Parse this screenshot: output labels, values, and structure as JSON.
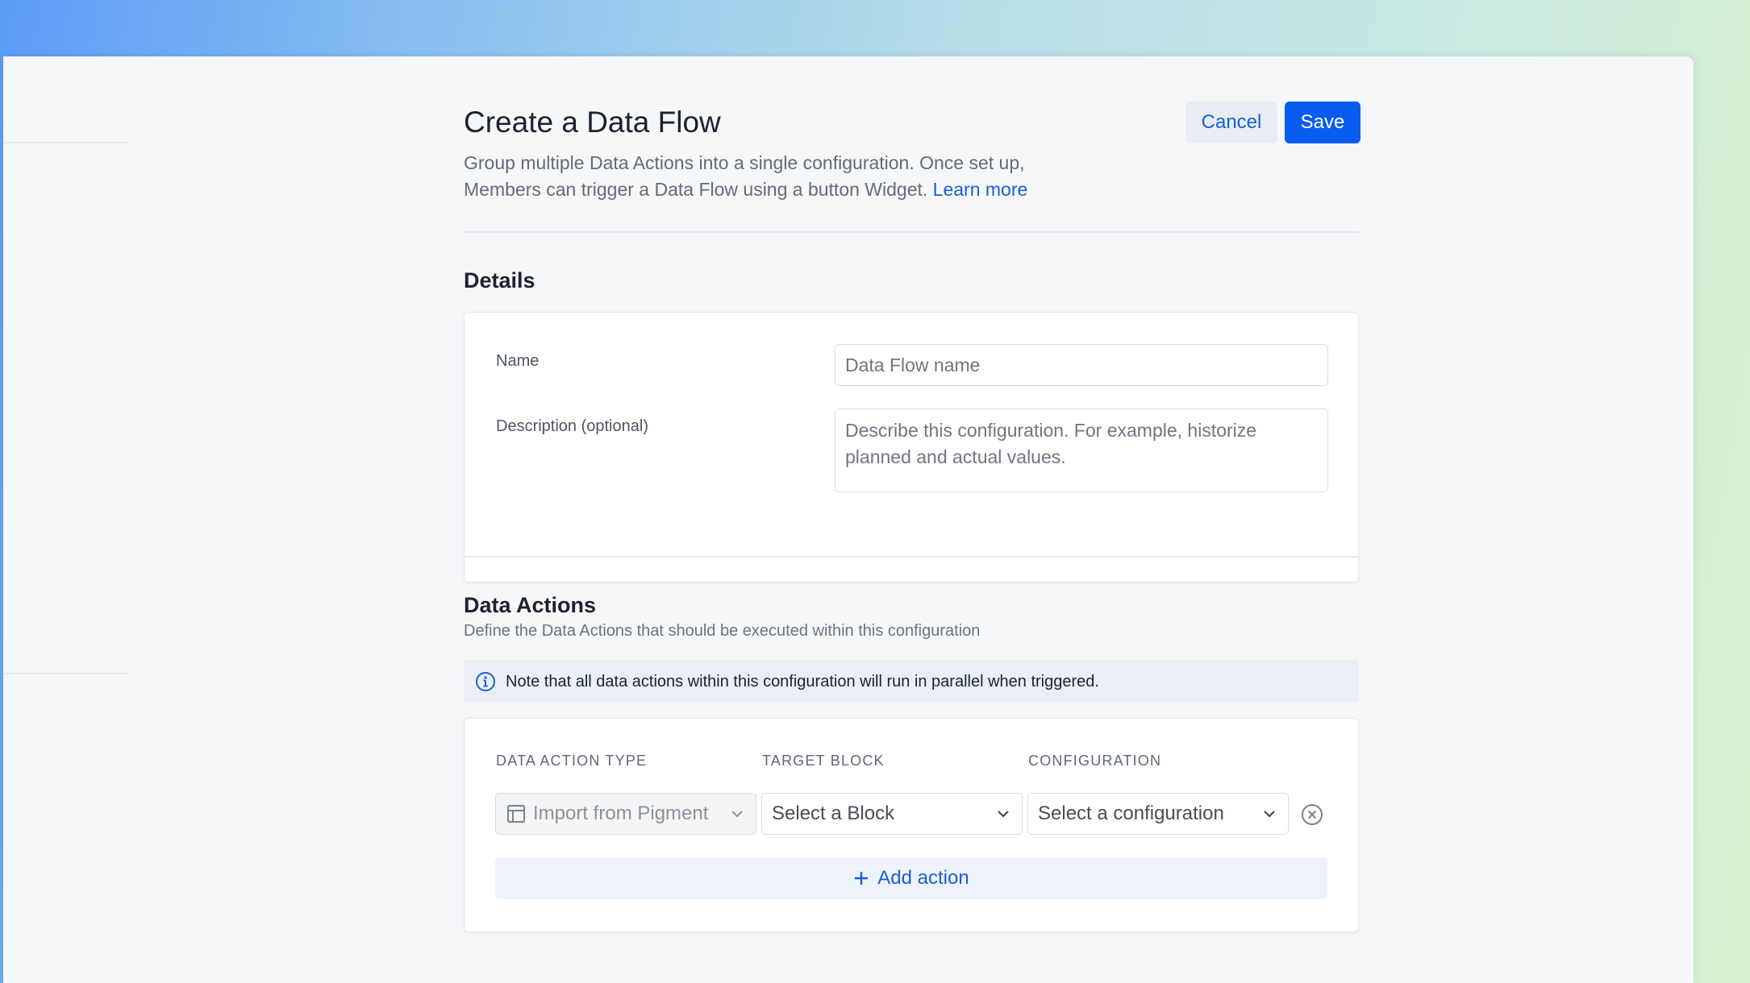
{
  "header": {
    "title": "Create a Data Flow",
    "description": "Group multiple Data Actions into a single configuration. Once set up, Members can trigger a Data Flow using a button Widget.",
    "learn_more": "Learn more",
    "cancel_label": "Cancel",
    "save_label": "Save"
  },
  "details": {
    "title": "Details",
    "name_label": "Name",
    "name_value": "",
    "name_placeholder": "Data Flow name",
    "description_label": "Description (optional)",
    "description_value": "",
    "description_placeholder": "Describe this configuration. For example, historize planned and actual values."
  },
  "data_actions": {
    "title": "Data Actions",
    "subtitle": "Define the Data Actions that should be executed within this configuration",
    "note": "Note that all data actions within this configuration will run in parallel when triggered.",
    "columns": [
      "DATA ACTION TYPE",
      "TARGET BLOCK",
      "CONFIGURATION"
    ],
    "rows": [
      {
        "type": "Import from Pigment",
        "target_block": "Select a Block",
        "configuration": "Select a configuration"
      }
    ],
    "add_action_label": "Add action"
  },
  "colors": {
    "accent": "#0a5cf0",
    "link": "#1a5fd0",
    "note_bg": "#eaeff6"
  },
  "icons": {
    "note": "info-circle-icon",
    "type": "block-layout-icon",
    "dropdown": "chevron-down-icon",
    "remove": "close-circle-icon",
    "add": "plus-icon"
  }
}
